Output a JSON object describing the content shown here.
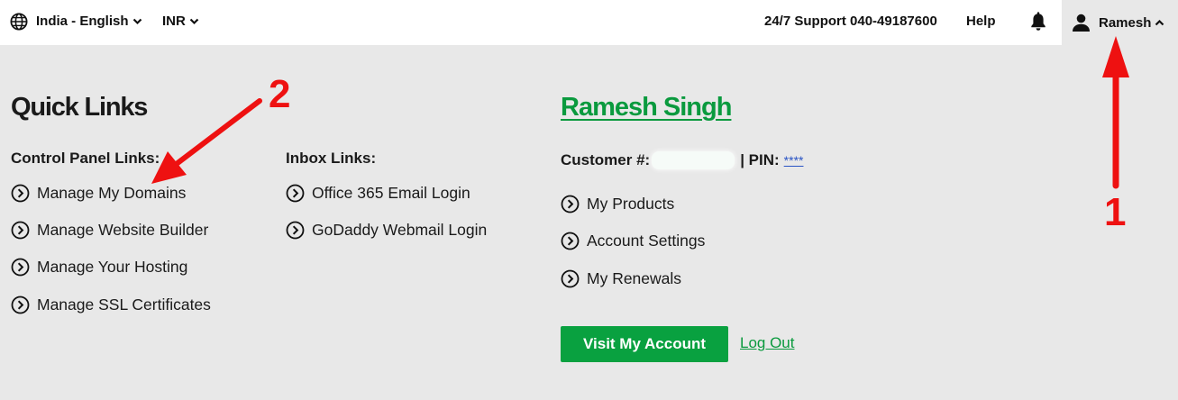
{
  "topbar": {
    "locale_label": "India - English",
    "currency_label": "INR",
    "support_label": "24/7 Support",
    "support_phone": "040-49187600",
    "help_label": "Help",
    "account_name": "Ramesh"
  },
  "quick_links": {
    "heading": "Quick Links",
    "control_panel": {
      "title": "Control Panel Links:",
      "items": [
        "Manage My Domains",
        "Manage Website Builder",
        "Manage Your Hosting",
        "Manage SSL Certificates"
      ]
    },
    "inbox": {
      "title": "Inbox Links:",
      "items": [
        "Office 365 Email Login",
        "GoDaddy Webmail Login"
      ]
    }
  },
  "account_panel": {
    "user_full_name": "Ramesh Singh",
    "customer_label": "Customer #:",
    "pin_label": "| PIN:",
    "pin_value": "****",
    "links": [
      "My Products",
      "Account Settings",
      "My Renewals"
    ],
    "visit_button": "Visit My Account",
    "logout_label": "Log Out"
  },
  "annotations": {
    "label_1": "1",
    "label_2": "2",
    "color": "#ee1111"
  },
  "colors": {
    "brand_green": "#09a140",
    "link_blue": "#2a54c4",
    "background": "#e8e8e8"
  },
  "icons": [
    "globe-icon",
    "chevron-down-icon",
    "bell-icon",
    "user-icon",
    "chevron-up-icon",
    "circle-chevron-right-icon"
  ]
}
